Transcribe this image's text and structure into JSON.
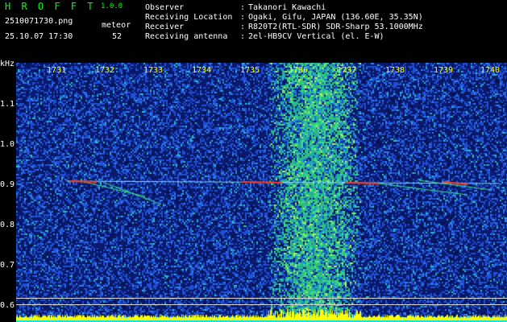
{
  "header": {
    "app_title": "H R O F F T",
    "app_version": "1.0.0",
    "filename": "2510071730.png",
    "type_label": "meteor",
    "datetime": "25.10.07 17:30",
    "count": "52",
    "info": [
      {
        "label": "Observer",
        "sep": ":",
        "value": "Takanori Kawachi"
      },
      {
        "label": "Receiving Location",
        "sep": ":",
        "value": "Ogaki, Gifu, JAPAN (136.60E, 35.35N)"
      },
      {
        "label": "Receiver",
        "sep": ":",
        "value": "R820T2(RTL-SDR) SDR-Sharp 53.1000MHz"
      },
      {
        "label": "Receiving antenna",
        "sep": ":",
        "value": "2el-HB9CV Vertical (el. E-W)"
      }
    ]
  },
  "axes": {
    "unit": "kHz",
    "x_labels": [
      "1731",
      "1732",
      "1733",
      "1734",
      "1735",
      "1736",
      "1737",
      "1738",
      "1739",
      "1740"
    ],
    "y_labels": [
      "1.1",
      "1.0",
      "0.9",
      "0.8",
      "0.7",
      "0.6"
    ]
  },
  "colors": {
    "title": "#00ff00",
    "header_text": "#ffffff",
    "x_labels": "#ffff00",
    "y_labels": "#ffffff",
    "background_noise": "#0a1a6e",
    "signal_band": "#2ec36b",
    "meteor_trail": "#ff3a1a",
    "bottom_activity": "#ffff00",
    "bottom_floor": "#00e5ff"
  }
}
